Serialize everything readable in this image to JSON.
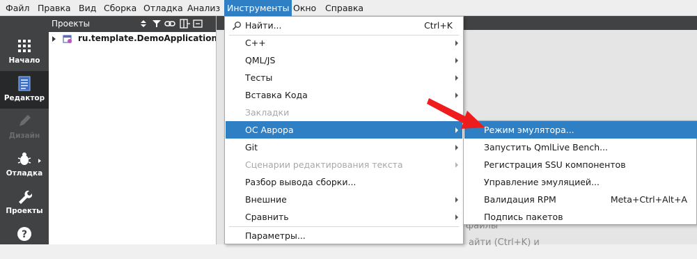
{
  "menubar": {
    "items": [
      "Файл",
      "Правка",
      "Вид",
      "Сборка",
      "Отладка",
      "Анализ",
      "Инструменты",
      "Окно",
      "Справка"
    ],
    "active_index": 6
  },
  "modes": [
    {
      "label": "Начало",
      "icon": "grid-icon",
      "state": "normal"
    },
    {
      "label": "Редактор",
      "icon": "document-icon",
      "state": "active"
    },
    {
      "label": "Дизайн",
      "icon": "pencil-icon",
      "state": "disabled"
    },
    {
      "label": "Отладка",
      "icon": "bug-icon",
      "state": "normal"
    },
    {
      "label": "Проекты",
      "icon": "wrench-icon",
      "state": "normal"
    },
    {
      "label": "",
      "icon": "help-icon",
      "state": "normal"
    }
  ],
  "projects_panel": {
    "title": "Проекты",
    "tree": [
      {
        "name": "ru.template.DemoApplication"
      }
    ]
  },
  "tools_menu": {
    "items": [
      {
        "label": "Найти...",
        "shortcut": "Ctrl+K",
        "submenu": false,
        "disabled": false
      },
      {
        "label": "C++",
        "shortcut": "",
        "submenu": true,
        "disabled": false
      },
      {
        "label": "QML/JS",
        "shortcut": "",
        "submenu": true,
        "disabled": false
      },
      {
        "label": "Тесты",
        "shortcut": "",
        "submenu": true,
        "disabled": false
      },
      {
        "label": "Вставка Кода",
        "shortcut": "",
        "submenu": true,
        "disabled": false
      },
      {
        "label": "Закладки",
        "shortcut": "",
        "submenu": false,
        "disabled": true
      },
      {
        "label": "ОС Аврора",
        "shortcut": "",
        "submenu": true,
        "disabled": false,
        "highlighted": true
      },
      {
        "label": "Git",
        "shortcut": "",
        "submenu": true,
        "disabled": false
      },
      {
        "label": "Сценарии редактирования текста",
        "shortcut": "",
        "submenu": true,
        "disabled": true
      },
      {
        "label": "Разбор вывода сборки...",
        "shortcut": "",
        "submenu": false,
        "disabled": false
      },
      {
        "label": "Внешние",
        "shortcut": "",
        "submenu": true,
        "disabled": false
      },
      {
        "label": "Сравнить",
        "shortcut": "",
        "submenu": true,
        "disabled": false
      },
      {
        "label": "Параметры...",
        "shortcut": "",
        "submenu": false,
        "disabled": false
      }
    ]
  },
  "aurora_submenu": {
    "items": [
      {
        "label": "Режим эмулятора...",
        "shortcut": "",
        "highlighted": true
      },
      {
        "label": "Запустить QmlLive Bench...",
        "shortcut": ""
      },
      {
        "label": "Регистрация SSU компонентов",
        "shortcut": ""
      },
      {
        "label": "Управление эмуляцией...",
        "shortcut": ""
      },
      {
        "label": "Валидация RPM",
        "shortcut": "Meta+Ctrl+Alt+A"
      },
      {
        "label": "Подпись пакетов",
        "shortcut": ""
      }
    ]
  },
  "editor_background": {
    "line1": "файлы",
    "line2": "айти (Ctrl+K) и"
  },
  "colors": {
    "highlight": "#2f7fc4",
    "sidebar": "#404244",
    "annotation_arrow": "#ee1c1c"
  }
}
